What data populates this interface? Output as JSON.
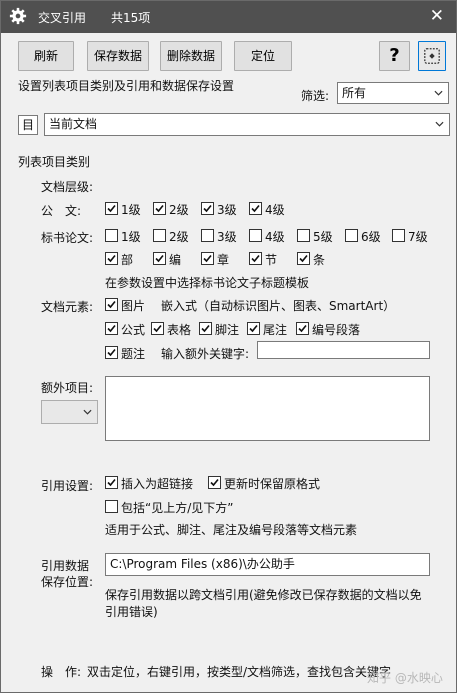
{
  "window": {
    "title": "交叉引用",
    "count": "共15项",
    "close_glyph": "✕"
  },
  "toolbar": {
    "refresh": "刷新",
    "save_data": "保存数据",
    "delete_data": "删除数据",
    "locate": "定位",
    "help": "?"
  },
  "settings_caption": "设置列表项目类别及引用和数据保存设置",
  "filter": {
    "label": "筛选:",
    "value": "所有"
  },
  "doc_select": {
    "icon_label": "目",
    "value": "当前文档"
  },
  "category_title": "列表项目类别",
  "levels": {
    "label": "文档层级:",
    "official_label": "公　文:",
    "official": [
      {
        "label": "1级",
        "checked": true
      },
      {
        "label": "2级",
        "checked": true
      },
      {
        "label": "3级",
        "checked": true
      },
      {
        "label": "4级",
        "checked": true
      }
    ],
    "tender_label": "标书论文:",
    "tender_row1": [
      {
        "label": "1级",
        "checked": false
      },
      {
        "label": "2级",
        "checked": false
      },
      {
        "label": "3级",
        "checked": false
      },
      {
        "label": "4级",
        "checked": false
      },
      {
        "label": "5级",
        "checked": false
      },
      {
        "label": "6级",
        "checked": false
      },
      {
        "label": "7级",
        "checked": false
      }
    ],
    "tender_row2": [
      {
        "label": "部",
        "checked": true
      },
      {
        "label": "编",
        "checked": true
      },
      {
        "label": "章",
        "checked": true
      },
      {
        "label": "节",
        "checked": true
      },
      {
        "label": "条",
        "checked": true
      }
    ],
    "template_hint": "在参数设置中选择标书论文子标题模板"
  },
  "elements": {
    "label": "文档元素:",
    "picture": {
      "label": "图片",
      "checked": true
    },
    "embedded_hint": "嵌入式（自动标识图片、图表、SmartArt）",
    "row2": [
      {
        "label": "公式",
        "checked": true
      },
      {
        "label": "表格",
        "checked": true
      },
      {
        "label": "脚注",
        "checked": true
      },
      {
        "label": "尾注",
        "checked": true
      },
      {
        "label": "编号段落",
        "checked": true
      }
    ],
    "caption": {
      "label": "题注",
      "checked": true
    },
    "keyword_label": "输入额外关键字:",
    "keyword_value": ""
  },
  "extra": {
    "label": "额外项目:",
    "select_value": "",
    "textarea_value": ""
  },
  "reference": {
    "label": "引用设置:",
    "hyperlink": {
      "label": "插入为超链接",
      "checked": true
    },
    "keep_format": {
      "label": "更新时保留原格式",
      "checked": true
    },
    "include_above": {
      "label": "包括“见上方/见下方”",
      "checked": false
    },
    "apply_hint": "适用于公式、脚注、尾注及编号段落等文档元素"
  },
  "storage": {
    "label_line1": "引用数据",
    "label_line2": "保存位置:",
    "path": "C:\\Program Files (x86)\\办公助手",
    "hint_line1": "保存引用数据以跨文档引用(避免修改已保存数据的文档以免",
    "hint_line2": "引用错误)"
  },
  "operation": {
    "label": "操　作:",
    "text": "双击定位，右键引用，按类型/文档筛选，查找包含关键字"
  },
  "watermark": "知乎 @水映心",
  "colors": {
    "titlebar": "#505050",
    "window_bg": "#f0f0f0",
    "focus": "#0078d7"
  }
}
